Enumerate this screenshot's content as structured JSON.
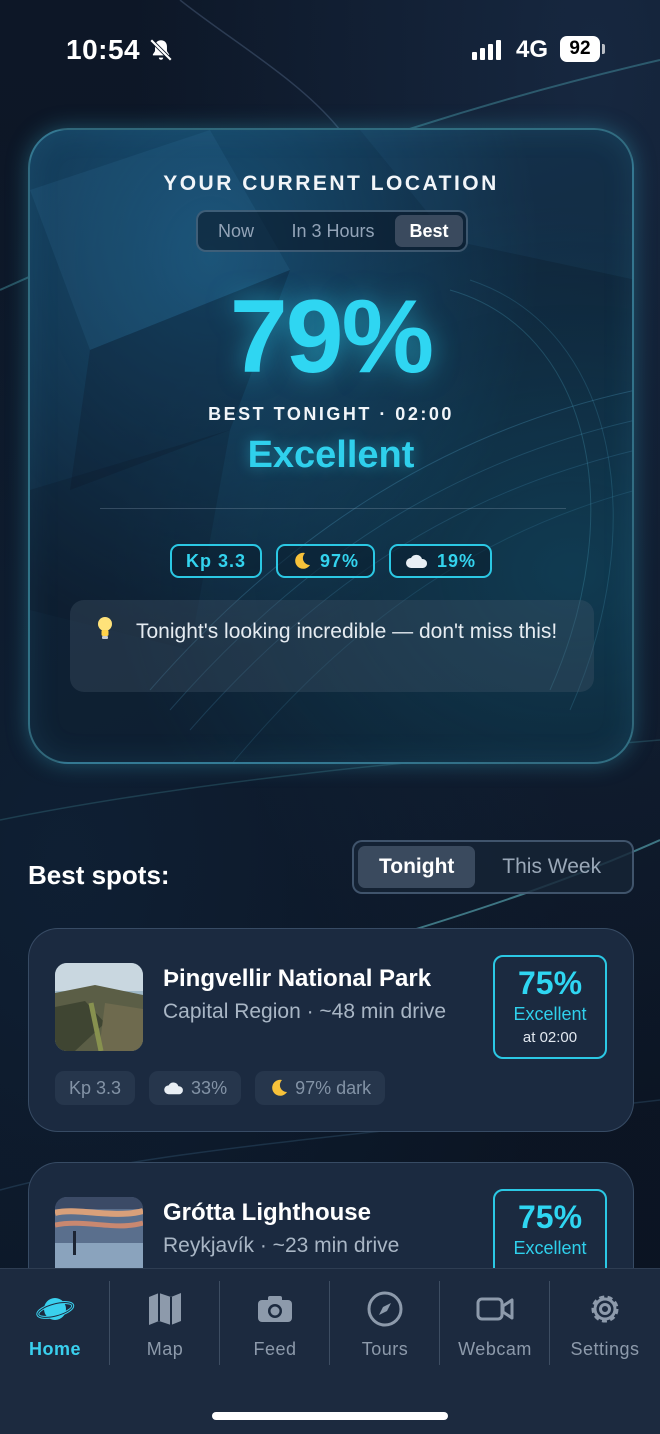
{
  "status_bar": {
    "time": "10:54",
    "network": "4G",
    "battery": "92"
  },
  "hero": {
    "title": "YOUR CURRENT LOCATION",
    "segments": [
      "Now",
      "In 3 Hours",
      "Best"
    ],
    "selected_segment": "Best",
    "percent": "79%",
    "best_line": "BEST TONIGHT · 02:00",
    "rating": "Excellent",
    "chips": [
      {
        "icon": "kp-index",
        "label": "Kp 3.3"
      },
      {
        "icon": "moon-icon",
        "label": "97%"
      },
      {
        "icon": "cloud-icon",
        "label": "19%"
      }
    ],
    "tip": "Tonight's looking incredible — don't miss this!"
  },
  "spots": {
    "title": "Best spots:",
    "tabs": [
      "Tonight",
      "This Week"
    ],
    "selected_tab": "Tonight",
    "items": [
      {
        "name": "Þingvellir National Park",
        "region": "Capital Region  ·  ~48 min drive",
        "percent": "75%",
        "rating": "Excellent",
        "time": "at 02:00",
        "stats": [
          "Kp 3.3",
          "33%",
          "97% dark"
        ]
      },
      {
        "name": "Grótta Lighthouse",
        "region": "Reykjavík  ·  ~23 min drive",
        "percent": "75%",
        "rating": "Excellent"
      }
    ]
  },
  "tabbar": {
    "items": [
      {
        "label": "Home",
        "icon": "planet-icon"
      },
      {
        "label": "Map",
        "icon": "map-icon"
      },
      {
        "label": "Feed",
        "icon": "camera-icon"
      },
      {
        "label": "Tours",
        "icon": "compass-icon"
      },
      {
        "label": "Webcam",
        "icon": "video-icon"
      },
      {
        "label": "Settings",
        "icon": "gear-icon"
      }
    ],
    "active": "Home"
  },
  "colors": {
    "accent": "#2fd6f2",
    "card": "#1b2a40",
    "background": "#0c1624"
  }
}
